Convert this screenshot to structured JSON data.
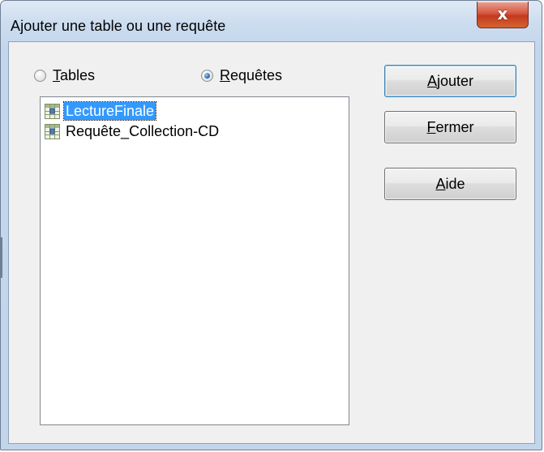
{
  "window": {
    "title": "Ajouter une table ou une requête",
    "close_glyph": "x"
  },
  "radios": {
    "tables": {
      "label_first": "T",
      "label_rest": "ables",
      "checked": false
    },
    "requetes": {
      "label_first": "R",
      "label_rest": "equêtes",
      "checked": true
    }
  },
  "list": {
    "items": [
      {
        "label": "LectureFinale",
        "selected": true,
        "icon": "query-icon"
      },
      {
        "label": "Requête_Collection-CD",
        "selected": false,
        "icon": "query-icon"
      }
    ]
  },
  "buttons": {
    "ajouter": {
      "mnemonic": "A",
      "rest": "jouter"
    },
    "fermer": {
      "mnemonic": "F",
      "rest": "ermer"
    },
    "aide": {
      "mnemonic": "A",
      "rest": "ide"
    }
  },
  "colors": {
    "selection": "#3399ff",
    "title_gradient_top": "#dfe9f5",
    "close_red": "#c33a1f"
  }
}
